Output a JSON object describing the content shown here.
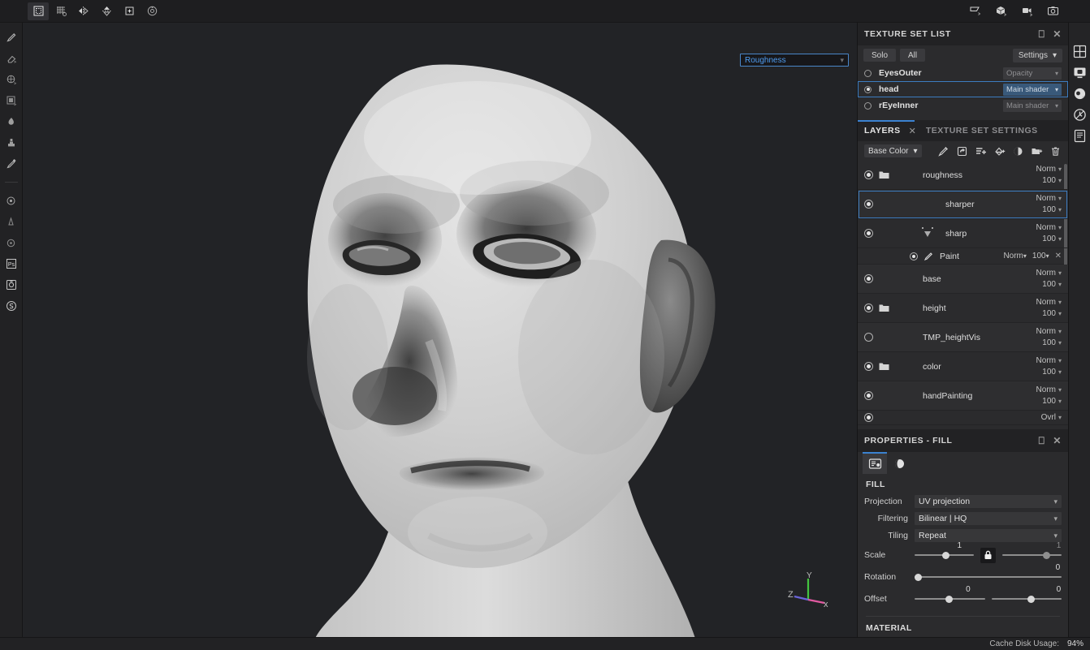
{
  "topbar": {
    "tools": [
      {
        "name": "uv-tile-icon",
        "label": "UV Tile"
      },
      {
        "name": "uv-grid-icon",
        "label": "UV Grid"
      },
      {
        "name": "symmetry-icon",
        "label": "Symmetry"
      },
      {
        "name": "mirror-icon",
        "label": "Mirror"
      },
      {
        "name": "add-plane-icon",
        "label": "Add Plane"
      },
      {
        "name": "rotate-icon",
        "label": "Rotate Environment"
      }
    ],
    "right_tools": [
      {
        "name": "flag-icon",
        "label": "Display Settings"
      },
      {
        "name": "cube-icon",
        "label": "Shader Settings"
      },
      {
        "name": "camera-video-icon",
        "label": "Camera Settings"
      },
      {
        "name": "screenshot-icon",
        "label": "Screenshot"
      }
    ]
  },
  "left_rail": {
    "tools": [
      {
        "name": "paint-brush-icon",
        "label": "Paint"
      },
      {
        "name": "eraser-icon",
        "label": "Eraser"
      },
      {
        "name": "projection-icon",
        "label": "Projection"
      },
      {
        "name": "polygon-fill-icon",
        "label": "Polygon Fill"
      },
      {
        "name": "smudge-icon",
        "label": "Smudge"
      },
      {
        "name": "clone-icon",
        "label": "Clone"
      },
      {
        "name": "material-picker-icon",
        "label": "Material Picker"
      }
    ],
    "bottom_tools": [
      {
        "name": "settings-gear-icon",
        "label": "Settings"
      },
      {
        "name": "particle-icon",
        "label": "Particles"
      },
      {
        "name": "physics-icon",
        "label": "Physics"
      },
      {
        "name": "photoshop-icon",
        "label": "Ps"
      },
      {
        "name": "baking-icon",
        "label": "Baking"
      },
      {
        "name": "substance-icon",
        "label": "Substance"
      }
    ]
  },
  "viewport": {
    "channel_dropdown": {
      "value": "Roughness",
      "color": "#4e9cf0"
    },
    "gizmo": {
      "x_label": "x",
      "y_label": "Y",
      "z_label": "Z",
      "x_color": "#e05aa0",
      "y_color": "#43c43f",
      "z_color": "#6a64d8"
    },
    "background_color": "#222326"
  },
  "texture_set_list": {
    "title": "TEXTURE SET LIST",
    "solo_label": "Solo",
    "all_label": "All",
    "settings_label": "Settings",
    "rows": [
      {
        "name": "EyesOuter",
        "selected": false,
        "radio_on": false,
        "shader": "Opacity"
      },
      {
        "name": "head",
        "selected": true,
        "radio_on": true,
        "shader": "Main shader"
      },
      {
        "name": "rEyeInner",
        "selected": false,
        "radio_on": false,
        "shader": "Main shader"
      }
    ]
  },
  "layers_panel": {
    "tab_layers": "LAYERS",
    "tab_texture_set_settings": "TEXTURE SET SETTINGS",
    "channel": "Base Color",
    "toolbar_icons": [
      {
        "name": "add-effect-icon",
        "label": "Add effect"
      },
      {
        "name": "add-adjustment-icon",
        "label": "Add adjustment"
      },
      {
        "name": "add-filter-icon",
        "label": "Add filter"
      },
      {
        "name": "add-fill-layer-icon",
        "label": "Add fill layer"
      },
      {
        "name": "add-mask-icon",
        "label": "Add mask"
      },
      {
        "name": "add-folder-icon",
        "label": "Add folder"
      },
      {
        "name": "delete-layer-icon",
        "label": "Delete layer"
      }
    ],
    "layers": [
      {
        "name": "roughness",
        "visible": true,
        "is_folder": true,
        "blend": "Norm",
        "opacity": "100",
        "selected": false,
        "thumbs": [
          "checker"
        ],
        "mask_bar": "gray"
      },
      {
        "name": "sharper",
        "visible": true,
        "is_folder": false,
        "blend": "Norm",
        "opacity": "100",
        "selected": true,
        "thumbs": [
          "checker",
          "dark"
        ],
        "mask_bar": "orange"
      },
      {
        "name": "sharp",
        "visible": true,
        "is_folder": false,
        "blend": "Norm",
        "opacity": "100",
        "selected": false,
        "thumbs": [
          "checker",
          "dark2"
        ],
        "mask_bar": "orange"
      },
      {
        "name": "base",
        "visible": true,
        "is_folder": false,
        "blend": "Norm",
        "opacity": "100",
        "selected": false,
        "thumbs": [
          "checker"
        ],
        "mask_bar": "gray"
      },
      {
        "name": "height",
        "visible": true,
        "is_folder": true,
        "blend": "Norm",
        "opacity": "100",
        "selected": false,
        "thumbs": [
          "checker"
        ],
        "mask_bar": "gray"
      },
      {
        "name": "TMP_heightVis",
        "visible": false,
        "is_folder": false,
        "blend": "Norm",
        "opacity": "100",
        "selected": false,
        "thumbs": [
          "solidgray"
        ],
        "mask_bar": "gray"
      },
      {
        "name": "color",
        "visible": true,
        "is_folder": true,
        "blend": "Norm",
        "opacity": "100",
        "selected": false,
        "thumbs": [
          "pink"
        ],
        "mask_bar": "gray"
      },
      {
        "name": "handPainting",
        "visible": true,
        "is_folder": false,
        "blend": "Norm",
        "opacity": "100",
        "selected": false,
        "thumbs": [
          "checker"
        ],
        "mask_bar": "gray"
      },
      {
        "name": "",
        "visible": true,
        "is_folder": false,
        "blend": "Ovrl",
        "opacity": "",
        "selected": false,
        "thumbs": [
          "magenta",
          "dark"
        ],
        "mask_bar": "none"
      }
    ],
    "sub_layer": {
      "name": "Paint",
      "visible": true,
      "blend": "Norm",
      "opacity": "100",
      "icon": "paint-brush-icon"
    }
  },
  "properties": {
    "title": "PROPERTIES - FILL",
    "tabs": [
      {
        "name": "material-params-tab-icon",
        "active": true
      },
      {
        "name": "shader-params-tab-icon",
        "active": false
      }
    ],
    "fill_section": "FILL",
    "material_section": "MATERIAL",
    "projection_label": "Projection",
    "projection_value": "UV projection",
    "filtering_label": "Filtering",
    "filtering_value": "Bilinear | HQ",
    "tiling_label": "Tiling",
    "tiling_value": "Repeat",
    "scale_label": "Scale",
    "scale_value_x": "1",
    "scale_value_y": "1",
    "rotation_label": "Rotation",
    "rotation_value": "0",
    "offset_label": "Offset",
    "offset_value_x": "0",
    "offset_value_y": "0",
    "lock_icon": "lock-icon"
  },
  "dock_rail": {
    "items": [
      {
        "name": "shelf-grid-icon",
        "label": "Shelf"
      },
      {
        "name": "display-settings-icon",
        "label": "Display settings"
      },
      {
        "name": "shader-settings-icon",
        "label": "Shader settings"
      },
      {
        "name": "history-icon",
        "label": "History"
      },
      {
        "name": "log-icon",
        "label": "Log"
      }
    ]
  },
  "statusbar": {
    "cache_label": "Cache Disk Usage:",
    "cache_value": "94%"
  }
}
